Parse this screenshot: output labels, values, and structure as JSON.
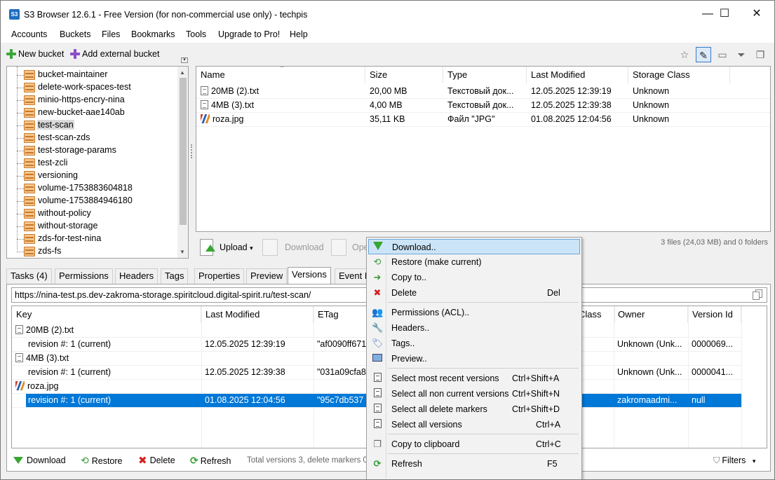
{
  "titlebar": {
    "app_icon": "S3",
    "title": "S3 Browser 12.6.1 - Free Version (for non-commercial use only) - techpis",
    "minimize": "—",
    "maximize": "☐",
    "close": "✕"
  },
  "menu": [
    "Accounts",
    "Buckets",
    "Files",
    "Bookmarks",
    "Tools",
    "Upgrade to Pro!",
    "Help"
  ],
  "left_toolbar": {
    "new_bucket": "New bucket",
    "add_external_bucket": "Add external bucket",
    "colors": {
      "new_bucket_icon": "#3aa63a",
      "external_icon": "#8a4fc9"
    }
  },
  "buckets": [
    "bucket-maintainer",
    "delete-work-spaces-test",
    "minio-https-encry-nina",
    "new-bucket-aae140ab",
    "test-scan",
    "test-scan-zds",
    "test-storage-params",
    "test-zcli",
    "versioning",
    "volume-1753883604818",
    "volume-1753884946180",
    "without-policy",
    "without-storage",
    "zds-for-test-nina",
    "zds-fs"
  ],
  "selected_bucket": "test-scan",
  "file_grid": {
    "columns": [
      "Name",
      "Size",
      "Type",
      "Last Modified",
      "Storage Class"
    ],
    "rows": [
      {
        "name": "20MB (2).txt",
        "size": "20,00 MB",
        "type": "Текстовый док...",
        "modified": "12.05.2025 12:39:19",
        "storage": "Unknown",
        "icon": "text-file-icon"
      },
      {
        "name": "4MB (3).txt",
        "size": "4,00 MB",
        "type": "Текстовый док...",
        "modified": "12.05.2025 12:39:38",
        "storage": "Unknown",
        "icon": "text-file-icon"
      },
      {
        "name": "roza.jpg",
        "size": "35,11 KB",
        "type": "Файл \"JPG\"",
        "modified": "01.08.2025 12:04:56",
        "storage": "Unknown",
        "icon": "image-file-icon"
      }
    ]
  },
  "action_bar": {
    "upload": "Upload",
    "upload_caret": "▾",
    "download": "Download",
    "open": "Ope",
    "status": "3 files (24,03 MB) and 0 folders"
  },
  "tabs": [
    "Tasks (4)",
    "Permissions",
    "Headers",
    "Tags",
    "Properties",
    "Preview",
    "Versions",
    "Event N"
  ],
  "active_tab": "Versions",
  "url": "https://nina-test.ps.dev-zakroma-storage.spiritcloud.digital-spirit.ru/test-scan/",
  "versions_grid": {
    "columns": [
      "Key",
      "Last Modified",
      "ETag",
      "Class",
      "Owner",
      "Version Id"
    ],
    "rows": [
      {
        "key": "20MB (2).txt",
        "is_file": true,
        "icon": "text-file-icon"
      },
      {
        "key": "revision #: 1 (current)",
        "modified": "12.05.2025 12:39:19",
        "etag": "\"af0090ff671",
        "owner": "Unknown (Unk...",
        "version": "0000069..."
      },
      {
        "key": "4MB (3).txt",
        "is_file": true,
        "icon": "text-file-icon"
      },
      {
        "key": "revision #: 1 (current)",
        "modified": "12.05.2025 12:39:38",
        "etag": "\"031a09cfa8",
        "owner": "Unknown (Unk...",
        "version": "0000041..."
      },
      {
        "key": "roza.jpg",
        "is_file": true,
        "icon": "image-file-icon"
      },
      {
        "key": "revision #: 1 (current)",
        "modified": "01.08.2025 12:04:56",
        "etag": "\"95c7db537",
        "owner": "zakromaadmi...",
        "version": "null",
        "selected": true
      }
    ]
  },
  "bottom_bar": {
    "download": "Download",
    "restore": "Restore",
    "delete": "Delete",
    "refresh": "Refresh",
    "status": "Total versions 3, delete markers 0,",
    "filters": "Filters",
    "filters_caret": "▾"
  },
  "context_menu": [
    {
      "label": "Download..",
      "shortcut": "",
      "icon": "download-icon",
      "highlighted": true
    },
    {
      "label": "Restore (make current)",
      "shortcut": "",
      "icon": "restore-icon"
    },
    {
      "label": "Copy to..",
      "shortcut": "",
      "icon": "copy-to-icon"
    },
    {
      "label": "Delete",
      "shortcut": "Del",
      "icon": "delete-icon",
      "sep_after": true
    },
    {
      "label": "Permissions (ACL)..",
      "shortcut": "",
      "icon": "permissions-icon"
    },
    {
      "label": "Headers..",
      "shortcut": "",
      "icon": "headers-icon"
    },
    {
      "label": "Tags..",
      "shortcut": "",
      "icon": "tags-icon"
    },
    {
      "label": "Preview..",
      "shortcut": "",
      "icon": "preview-icon",
      "sep_after": true
    },
    {
      "label": "Select most recent versions",
      "shortcut": "Ctrl+Shift+A",
      "icon": "select-icon"
    },
    {
      "label": "Select all non current versions",
      "shortcut": "Ctrl+Shift+N",
      "icon": "select-icon"
    },
    {
      "label": "Select all delete markers",
      "shortcut": "Ctrl+Shift+D",
      "icon": "select-icon"
    },
    {
      "label": "Select all versions",
      "shortcut": "Ctrl+A",
      "icon": "select-icon",
      "sep_after": true
    },
    {
      "label": "Copy to clipboard",
      "shortcut": "Ctrl+C",
      "icon": "clipboard-icon",
      "sep_after": true
    },
    {
      "label": "Refresh",
      "shortcut": "F5",
      "icon": "refresh-icon"
    }
  ],
  "colors": {
    "selection": "#0078d7",
    "menu_highlight": "#cce4f7",
    "green_arrow": "#37a532",
    "delete_red": "#d42020"
  }
}
